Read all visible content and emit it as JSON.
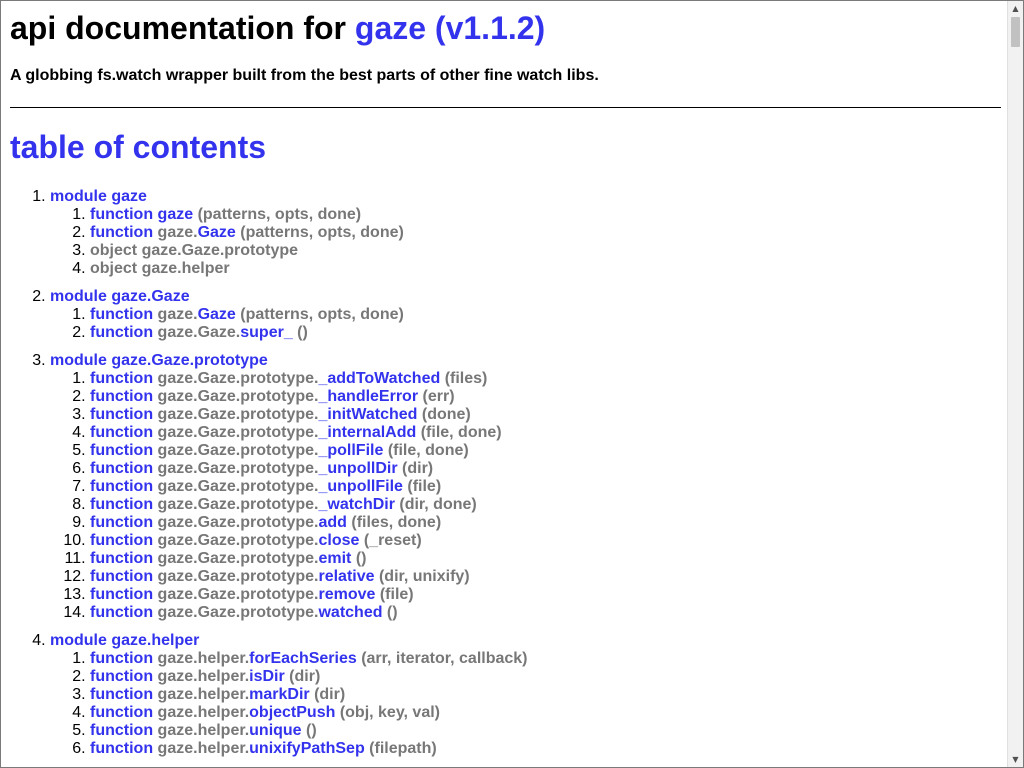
{
  "header": {
    "title_prefix": "api documentation for ",
    "title_link": "gaze (v1.1.2)",
    "description": "A globbing fs.watch wrapper built from the best parts of other fine watch libs."
  },
  "toc_title": "table of contents",
  "toc": [
    {
      "module": "module gaze",
      "items": [
        {
          "kind": "function",
          "prefix": "",
          "name": "gaze",
          "args": " (patterns, opts, done)"
        },
        {
          "kind": "function",
          "prefix": "gaze.",
          "name": "Gaze",
          "args": " (patterns, opts, done)"
        },
        {
          "kind": "object",
          "prefix": "",
          "name": "gaze.Gaze.prototype",
          "args": ""
        },
        {
          "kind": "object",
          "prefix": "",
          "name": "gaze.helper",
          "args": ""
        }
      ]
    },
    {
      "module": "module gaze.Gaze",
      "items": [
        {
          "kind": "function",
          "prefix": "gaze.",
          "name": "Gaze",
          "args": " (patterns, opts, done)"
        },
        {
          "kind": "function",
          "prefix": "gaze.Gaze.",
          "name": "super_",
          "args": " ()"
        }
      ]
    },
    {
      "module": "module gaze.Gaze.prototype",
      "items": [
        {
          "kind": "function",
          "prefix": "gaze.Gaze.prototype.",
          "name": "_addToWatched",
          "args": " (files)"
        },
        {
          "kind": "function",
          "prefix": "gaze.Gaze.prototype.",
          "name": "_handleError",
          "args": " (err)"
        },
        {
          "kind": "function",
          "prefix": "gaze.Gaze.prototype.",
          "name": "_initWatched",
          "args": " (done)"
        },
        {
          "kind": "function",
          "prefix": "gaze.Gaze.prototype.",
          "name": "_internalAdd",
          "args": " (file, done)"
        },
        {
          "kind": "function",
          "prefix": "gaze.Gaze.prototype.",
          "name": "_pollFile",
          "args": " (file, done)"
        },
        {
          "kind": "function",
          "prefix": "gaze.Gaze.prototype.",
          "name": "_unpollDir",
          "args": " (dir)"
        },
        {
          "kind": "function",
          "prefix": "gaze.Gaze.prototype.",
          "name": "_unpollFile",
          "args": " (file)"
        },
        {
          "kind": "function",
          "prefix": "gaze.Gaze.prototype.",
          "name": "_watchDir",
          "args": " (dir, done)"
        },
        {
          "kind": "function",
          "prefix": "gaze.Gaze.prototype.",
          "name": "add",
          "args": " (files, done)"
        },
        {
          "kind": "function",
          "prefix": "gaze.Gaze.prototype.",
          "name": "close",
          "args": " (_reset)"
        },
        {
          "kind": "function",
          "prefix": "gaze.Gaze.prototype.",
          "name": "emit",
          "args": " ()"
        },
        {
          "kind": "function",
          "prefix": "gaze.Gaze.prototype.",
          "name": "relative",
          "args": " (dir, unixify)"
        },
        {
          "kind": "function",
          "prefix": "gaze.Gaze.prototype.",
          "name": "remove",
          "args": " (file)"
        },
        {
          "kind": "function",
          "prefix": "gaze.Gaze.prototype.",
          "name": "watched",
          "args": " ()"
        }
      ]
    },
    {
      "module": "module gaze.helper",
      "items": [
        {
          "kind": "function",
          "prefix": "gaze.helper.",
          "name": "forEachSeries",
          "args": " (arr, iterator, callback)"
        },
        {
          "kind": "function",
          "prefix": "gaze.helper.",
          "name": "isDir",
          "args": " (dir)"
        },
        {
          "kind": "function",
          "prefix": "gaze.helper.",
          "name": "markDir",
          "args": " (dir)"
        },
        {
          "kind": "function",
          "prefix": "gaze.helper.",
          "name": "objectPush",
          "args": " (obj, key, val)"
        },
        {
          "kind": "function",
          "prefix": "gaze.helper.",
          "name": "unique",
          "args": " ()"
        },
        {
          "kind": "function",
          "prefix": "gaze.helper.",
          "name": "unixifyPathSep",
          "args": " (filepath)"
        }
      ]
    }
  ],
  "scrollbar": {
    "up_icon": "triangle-up-icon",
    "down_icon": "triangle-down-icon"
  },
  "colors": {
    "link": "#3333ee",
    "muted": "#777777"
  }
}
